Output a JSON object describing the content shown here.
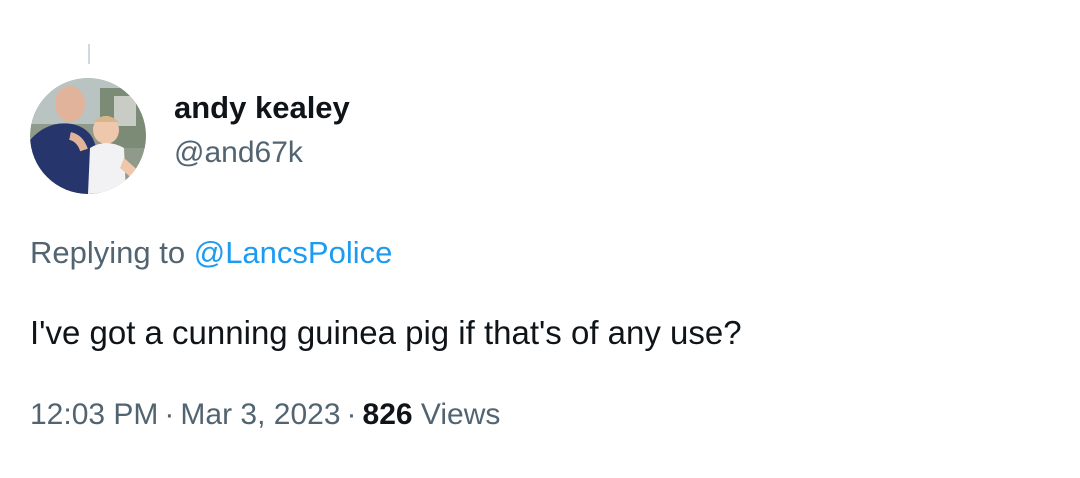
{
  "author": {
    "display_name": "andy kealey",
    "handle": "@and67k"
  },
  "reply": {
    "prefix": "Replying to",
    "mention": "@LancsPolice"
  },
  "tweet": {
    "text": "I've got a cunning guinea pig if that's of any use?"
  },
  "meta": {
    "time": "12:03 PM",
    "separator": "·",
    "date": "Mar 3, 2023",
    "views_count": "826",
    "views_label": "Views"
  },
  "colors": {
    "text_primary": "#0f1419",
    "text_secondary": "#536471",
    "link": "#1d9bf0",
    "thread_line": "#cfd9de"
  },
  "icons": {
    "avatar": "profile-photo"
  }
}
